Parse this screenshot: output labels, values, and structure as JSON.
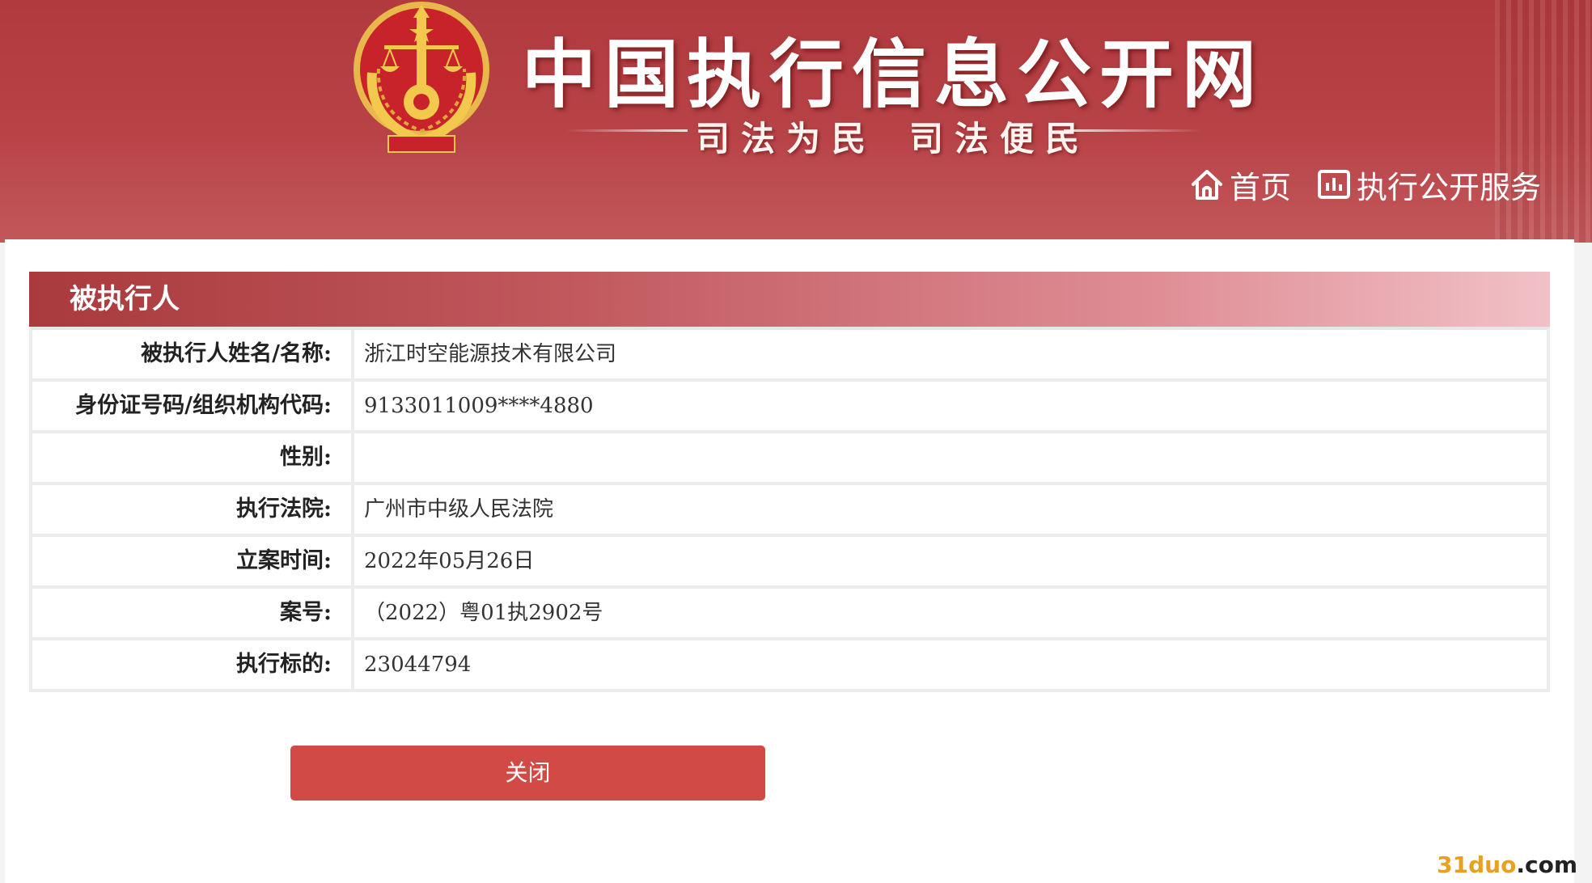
{
  "header": {
    "site_title": "中国执行信息公开网",
    "slogan_left": "司法为民",
    "slogan_right": "司法便民",
    "nav": {
      "home_label": "首页",
      "service_label": "执行公开服务"
    }
  },
  "section": {
    "title": "被执行人"
  },
  "fields": [
    {
      "label": "被执行人姓名/名称:",
      "value": "浙江时空能源技术有限公司"
    },
    {
      "label": "身份证号码/组织机构代码:",
      "value": "9133011009****4880"
    },
    {
      "label": "性别:",
      "value": ""
    },
    {
      "label": "执行法院:",
      "value": "广州市中级人民法院"
    },
    {
      "label": "立案时间:",
      "value": "2022年05月26日"
    },
    {
      "label": "案号:",
      "value": "（2022）粤01执2902号"
    },
    {
      "label": "执行标的:",
      "value": "23044794"
    }
  ],
  "close_button_label": "关闭",
  "watermark": {
    "part_a": "31duo",
    "part_b": ".com"
  },
  "colors": {
    "header_red": "#b03a3e",
    "button_red": "#d24a46",
    "section_gradient_start": "#a93a3d",
    "section_gradient_end": "#f1c1c7"
  },
  "icons": {
    "home": "house-icon",
    "service": "chart-panel-icon",
    "emblem": "court-emblem-icon"
  }
}
